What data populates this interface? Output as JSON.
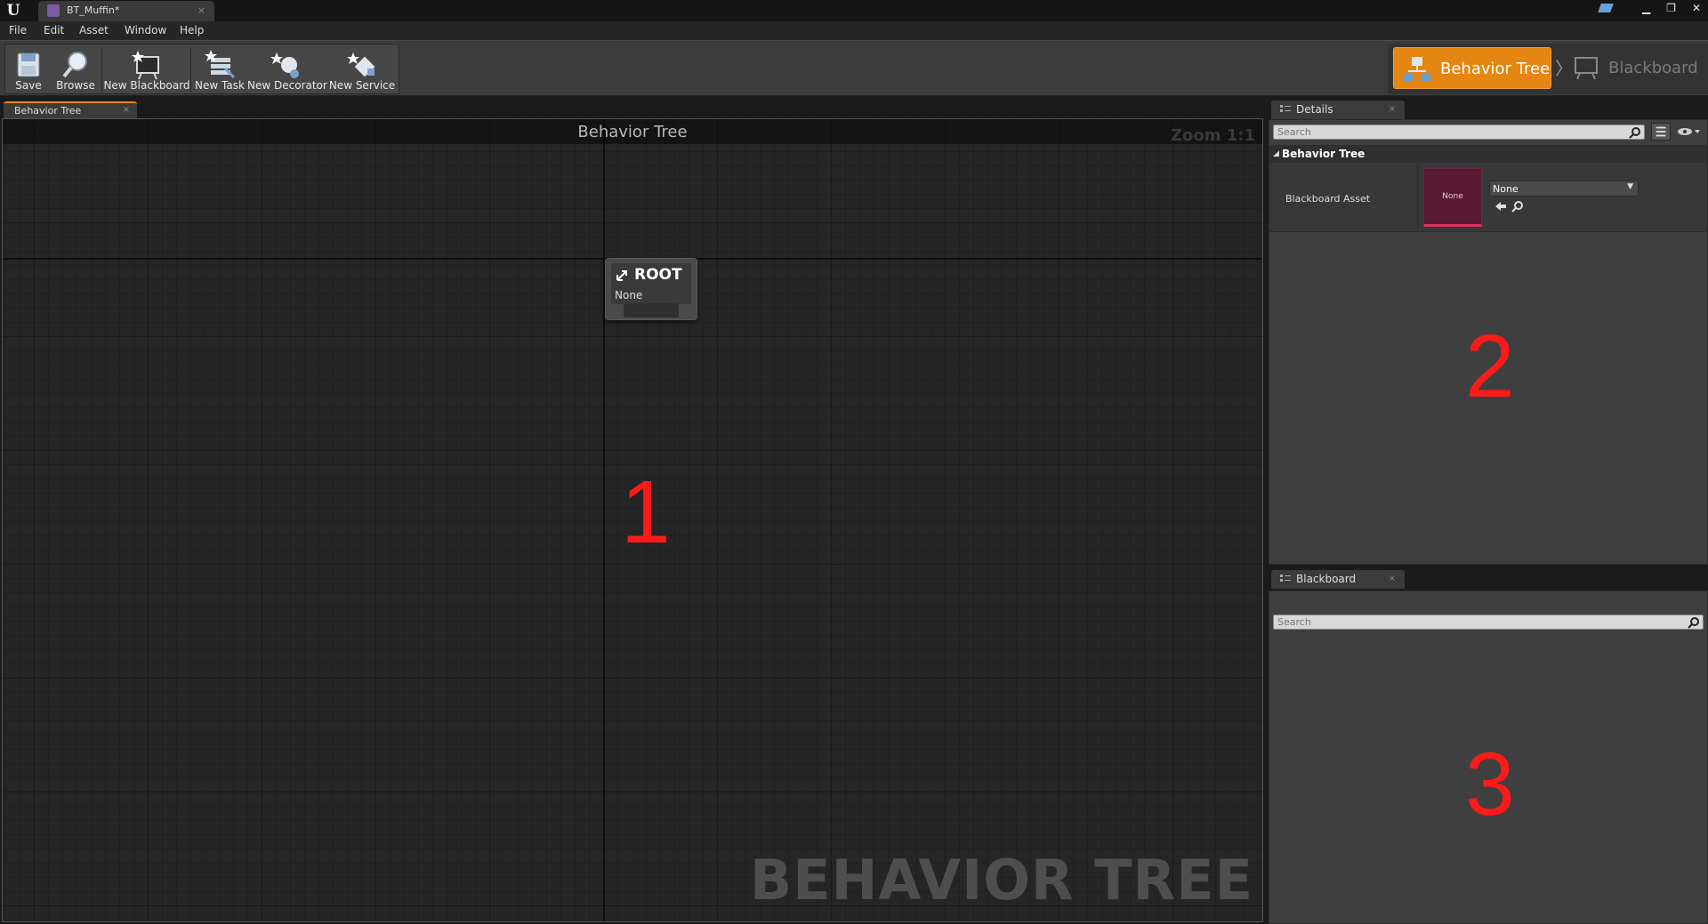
{
  "titlebar": {
    "document_tab": "BT_Muffin*",
    "window_buttons": [
      "minimize",
      "restore",
      "close"
    ]
  },
  "menu": [
    "File",
    "Edit",
    "Asset",
    "Window",
    "Help"
  ],
  "toolbar": {
    "save": "Save",
    "browse": "Browse",
    "new_blackboard": "New Blackboard",
    "new_task": "New Task",
    "new_decorator": "New Decorator",
    "new_service": "New Service"
  },
  "modes": {
    "behavior_tree": "Behavior Tree",
    "blackboard": "Blackboard",
    "active": "Behavior Tree",
    "accent": "#e48611"
  },
  "graph": {
    "tab_label": "Behavior Tree",
    "title": "Behavior Tree",
    "zoom": "Zoom 1:1",
    "watermark": "BEHAVIOR TREE",
    "root_node": {
      "name": "ROOT",
      "subtitle": "None"
    }
  },
  "details": {
    "tab_label": "Details",
    "search_placeholder": "Search",
    "category": "Behavior Tree",
    "property_label": "Blackboard Asset",
    "thumbnail_text": "None",
    "combo_value": "None"
  },
  "blackboard_panel": {
    "tab_label": "Blackboard",
    "search_placeholder": "Search"
  },
  "annotations": {
    "marker_1": "1",
    "marker_2": "2",
    "marker_3": "3",
    "color": "#ff1a1a"
  }
}
